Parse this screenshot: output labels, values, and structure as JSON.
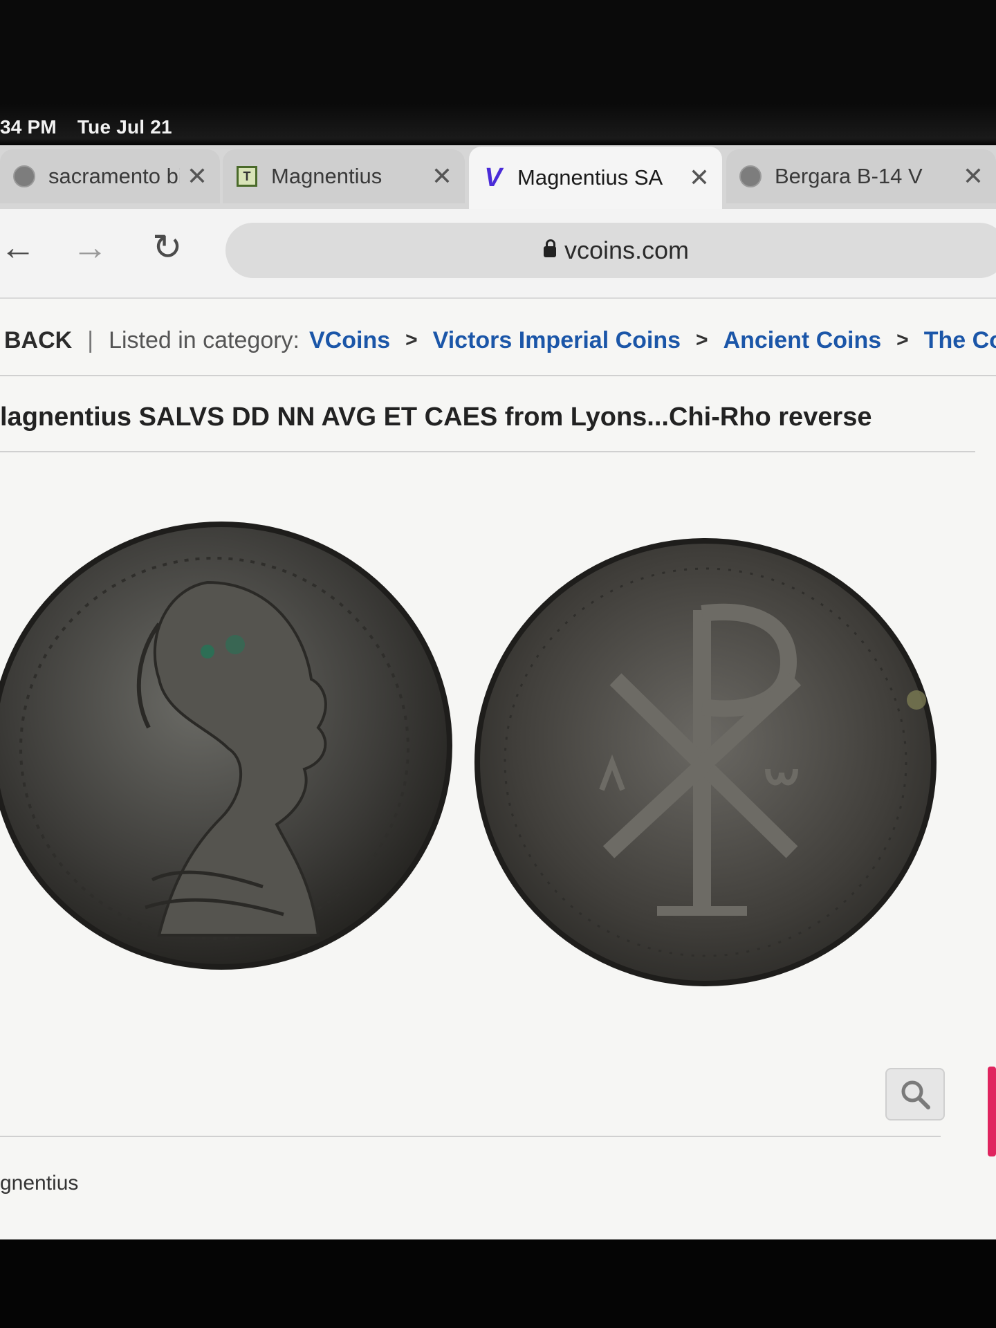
{
  "status_bar": {
    "time": "34 PM",
    "date": "Tue Jul 21"
  },
  "tabs": [
    {
      "title": "sacramento bic",
      "icon": "globe-icon",
      "active": false
    },
    {
      "title": "Magnentius",
      "icon": "site-favicon",
      "active": false
    },
    {
      "title": "Magnentius SA",
      "icon": "vcoins-v-icon",
      "active": true
    },
    {
      "title": "Bergara B-14 V",
      "icon": "globe-icon",
      "active": false
    }
  ],
  "toolbar": {
    "url": "vcoins.com"
  },
  "breadcrumb": {
    "back": "BACK",
    "divider": "|",
    "listed_label": "Listed in category:",
    "items": [
      "VCoins",
      "Victors Imperial Coins",
      "Ancient Coins",
      "The Const"
    ],
    "separator": ">"
  },
  "listing": {
    "title": "lagnentius SALVS DD NN AVG ET CAES from Lyons...Chi-Rho reverse"
  },
  "footer": {
    "label": "gnentius"
  },
  "colors": {
    "link": "#1b56a8",
    "accent": "#4a2bd8",
    "page_bg": "#f6f6f4"
  }
}
